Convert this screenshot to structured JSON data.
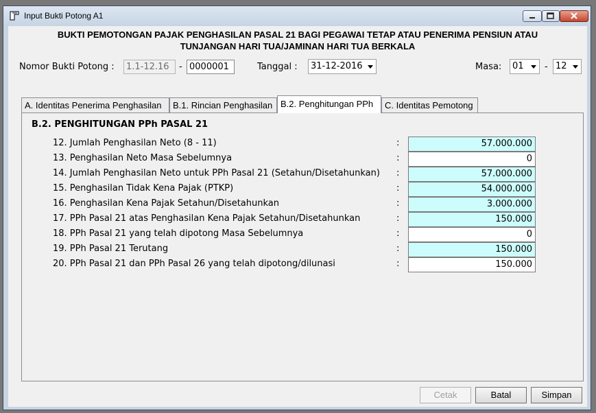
{
  "window": {
    "title": "Input Bukti Potong A1"
  },
  "header": {
    "line1": "BUKTI PEMOTONGAN PAJAK PENGHASILAN PASAL 21 BAGI PEGAWAI TETAP ATAU PENERIMA PENSIUN ATAU",
    "line2": "TUNJANGAN HARI TUA/JAMINAN HARI TUA BERKALA"
  },
  "form": {
    "nomor_label": "Nomor Bukti Potong :",
    "nomor_prefix": "1.1-12.16",
    "nomor_dash": "-",
    "nomor_value": "0000001",
    "tanggal_label": "Tanggal :",
    "tanggal_value": "31-12-2016",
    "masa_label": "Masa:",
    "masa_from": "01",
    "masa_dash": "-",
    "masa_to": "12"
  },
  "tabs": [
    {
      "label": "A. Identitas Penerima Penghasilan"
    },
    {
      "label": "B.1. Rincian Penghasilan"
    },
    {
      "label": "B.2. Penghitungan PPh"
    },
    {
      "label": "C. Identitas Pemotong"
    }
  ],
  "section": {
    "title": "B.2. PENGHITUNGAN PPh PASAL 21",
    "rows": [
      {
        "label": "12. Jumlah Penghasilan Neto (8 - 11)",
        "value": "57.000.000"
      },
      {
        "label": "13. Penghasilan Neto Masa Sebelumnya",
        "value": "0"
      },
      {
        "label": "14. Jumlah Penghasilan Neto untuk PPh Pasal 21 (Setahun/Disetahunkan)",
        "value": "57.000.000"
      },
      {
        "label": "15. Penghasilan Tidak Kena Pajak (PTKP)",
        "value": "54.000.000"
      },
      {
        "label": "16. Penghasilan Kena Pajak Setahun/Disetahunkan",
        "value": "3.000.000"
      },
      {
        "label": "17. PPh Pasal 21 atas Penghasilan Kena Pajak Setahun/Disetahunkan",
        "value": "150.000"
      },
      {
        "label": "18. PPh Pasal 21 yang telah dipotong Masa Sebelumnya",
        "value": "0"
      },
      {
        "label": "19. PPh Pasal 21 Terutang",
        "value": "150.000"
      },
      {
        "label": "20. PPh Pasal 21 dan PPh Pasal 26 yang telah dipotong/dilunasi",
        "value": "150.000"
      }
    ],
    "colon": ":"
  },
  "buttons": {
    "cetak": "Cetak",
    "batal": "Batal",
    "simpan": "Simpan"
  },
  "colors": {
    "computed_field": "#ccfcfc",
    "title_bar": "#c8d4e2"
  }
}
